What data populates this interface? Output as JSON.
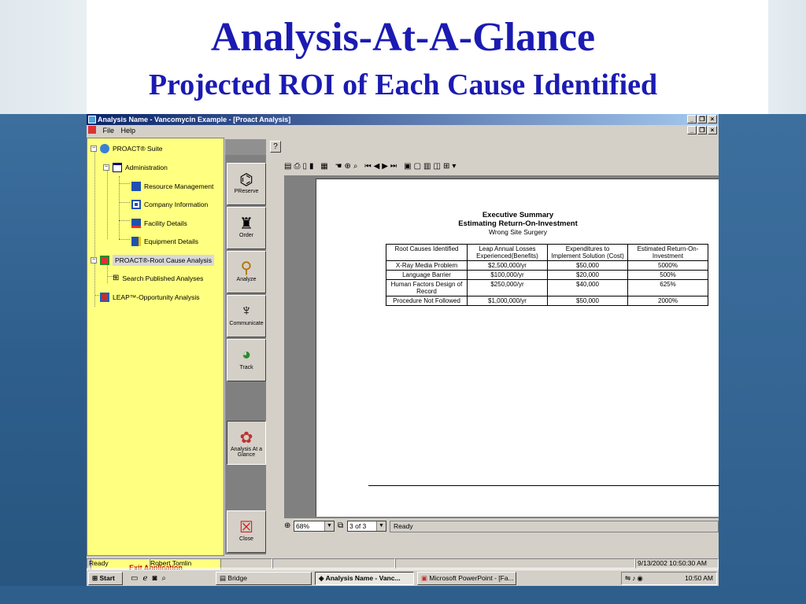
{
  "slide": {
    "title": "Analysis-At-A-Glance",
    "subtitle": "Projected ROI of Each Cause Identified"
  },
  "window": {
    "title": "Analysis Name - Vancomycin Example - [Proact Analysis]",
    "menu": [
      "File",
      "Help"
    ],
    "buttons": {
      "minimize": "_",
      "restore": "❐",
      "close": "×"
    }
  },
  "tree": {
    "items": [
      {
        "label": "PROACT® Suite"
      },
      {
        "label": "Administration"
      },
      {
        "label": "Resource Management"
      },
      {
        "label": "Company Information"
      },
      {
        "label": "Facility Details"
      },
      {
        "label": "Equipment Details"
      },
      {
        "label": "PROACT®-Root Cause Analysis"
      },
      {
        "label": "Search Published Analyses"
      },
      {
        "label": "LEAP™-Opportunity Analysis"
      }
    ],
    "exit_label": "Exit Application"
  },
  "tools": [
    {
      "label": "PReserve",
      "icon": "camera-icon"
    },
    {
      "label": "Order",
      "icon": "chair-icon"
    },
    {
      "label": "Analyze",
      "icon": "magnifier-icon"
    },
    {
      "label": "Communicate",
      "icon": "microphone-icon"
    },
    {
      "label": "Track",
      "icon": "pie-chart-icon"
    },
    {
      "label": "Analysis At a Glance",
      "icon": "palette-icon"
    },
    {
      "label": "Close",
      "icon": "close-icon"
    }
  ],
  "report": {
    "heading1": "Executive Summary",
    "heading2": "Estimating Return-On-Investment",
    "heading3": "Wrong Site Surgery",
    "columns": [
      "Root Causes Identified",
      "Leap Annual Losses Experienced(Benefits)",
      "Expenditures to Implement Solution (Cost)",
      "Estimated Return-On-Investment"
    ],
    "rows": [
      [
        "X-Ray Media Problem",
        "$2,500,000/yr",
        "$50,000",
        "5000%"
      ],
      [
        "Language Barrier",
        "$100,000/yr",
        "$20,000",
        "500%"
      ],
      [
        "Human Factors Design of Record",
        "$250,000/yr",
        "$40,000",
        "625%"
      ],
      [
        "Procedure Not Followed",
        "$1,000,000/yr",
        "$50,000",
        "2000%"
      ]
    ]
  },
  "viewer": {
    "zoom": "68%",
    "page": "3 of 3",
    "status": "Ready"
  },
  "statusbar": {
    "status": "Ready",
    "user": "Robert Tomlin",
    "datetime": "9/13/2002 10:50:30 AM"
  },
  "taskbar": {
    "start": "Start",
    "tasks": [
      "Bridge",
      "Analysis Name - Vanc...",
      "Microsoft PowerPoint - [Fa..."
    ],
    "clock": "10:50 AM"
  },
  "colors": {
    "tree_bg": "#ffff80",
    "title_blue": "#1b1bb3",
    "exit_red": "#b00000"
  }
}
